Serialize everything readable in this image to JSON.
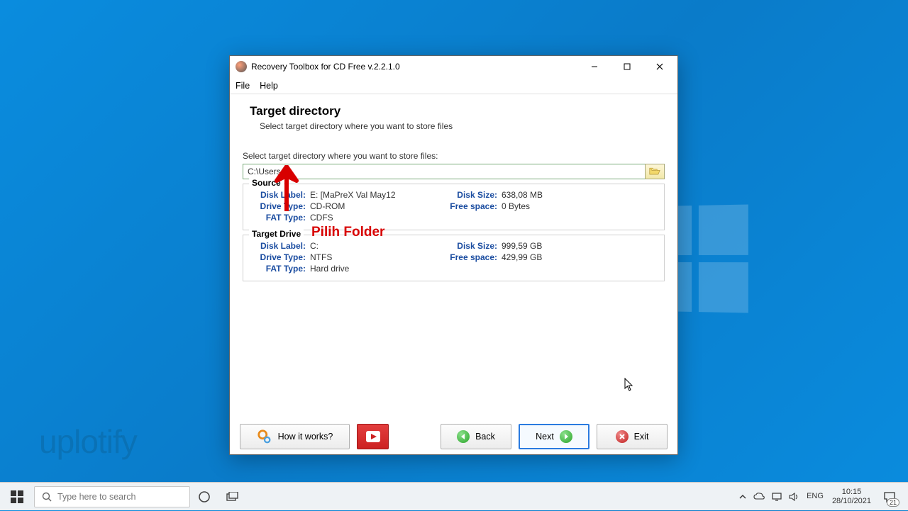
{
  "window": {
    "title": "Recovery Toolbox for CD Free v.2.2.1.0",
    "menus": {
      "file": "File",
      "help": "Help"
    }
  },
  "page": {
    "heading": "Target directory",
    "subheading": "Select target directory where you want to store files",
    "instruction": "Select target directory where you want to store files:",
    "path_value": "C:\\Users"
  },
  "source": {
    "legend": "Source",
    "disk_label_lbl": "Disk Label:",
    "disk_label_val": "E: [MaPreX Val May12",
    "drive_type_lbl": "Drive Type:",
    "drive_type_val": "CD-ROM",
    "fat_type_lbl": "FAT Type:",
    "fat_type_val": "CDFS",
    "disk_size_lbl": "Disk Size:",
    "disk_size_val": "638,08 MB",
    "free_space_lbl": "Free space:",
    "free_space_val": "0 Bytes"
  },
  "target": {
    "legend": "Target Drive",
    "disk_label_lbl": "Disk Label:",
    "disk_label_val": "C:",
    "drive_type_lbl": "Drive Type:",
    "drive_type_val": "NTFS",
    "fat_type_lbl": "FAT Type:",
    "fat_type_val": "Hard drive",
    "disk_size_lbl": "Disk Size:",
    "disk_size_val": "999,59 GB",
    "free_space_lbl": "Free space:",
    "free_space_val": "429,99 GB"
  },
  "annotation": {
    "label": "Pilih Folder"
  },
  "footer": {
    "how": "How it works?",
    "back": "Back",
    "next": "Next",
    "exit": "Exit"
  },
  "taskbar": {
    "search_placeholder": "Type here to search",
    "lang": "ENG",
    "time": "10:15",
    "date": "28/10/2021",
    "notif_count": "21"
  },
  "watermark": "uplotify"
}
